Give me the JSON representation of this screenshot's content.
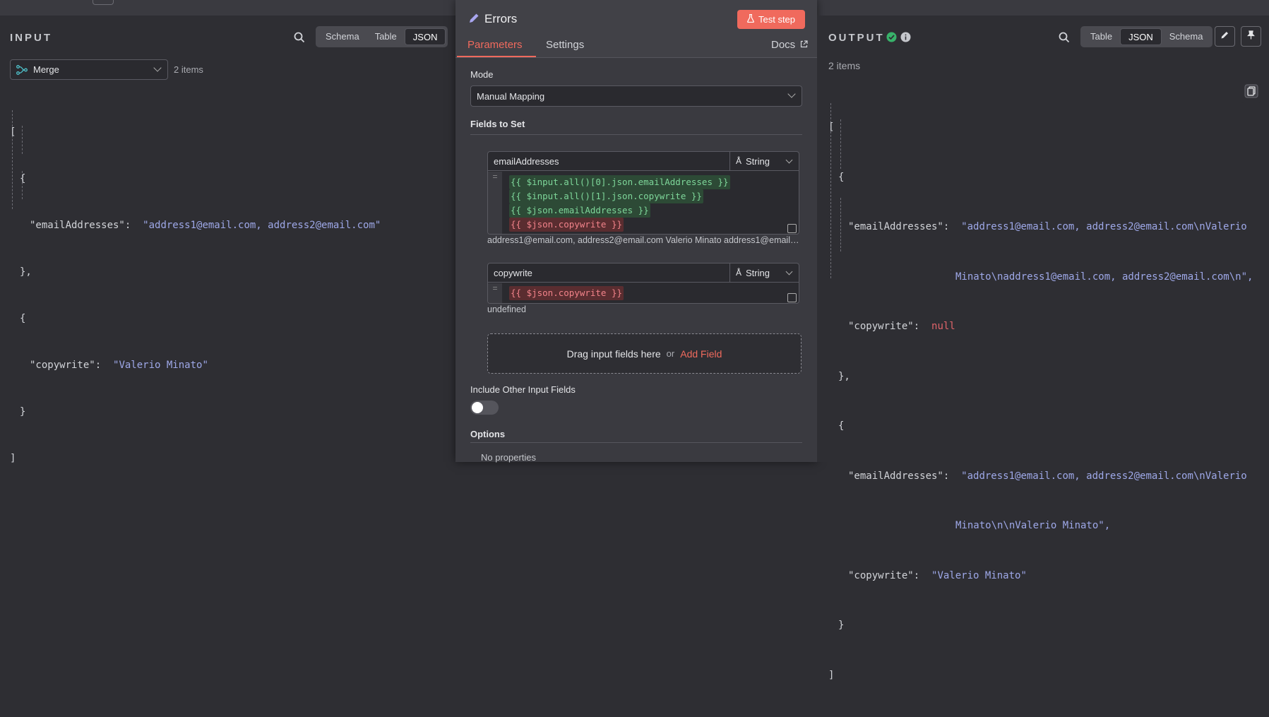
{
  "topbar": {
    "ghost_text": ""
  },
  "input": {
    "title": "INPUT",
    "views": [
      "Schema",
      "Table",
      "JSON"
    ],
    "active_view": "JSON",
    "node_select": "Merge",
    "item_count": "2 items",
    "json_lines": [
      "[",
      "{",
      "\"emailAddresses\":",
      "\"address1@email.com, address2@email.com\"",
      "},",
      "{",
      "\"copywrite\":",
      "\"Valerio Minato\"",
      "}",
      "]"
    ]
  },
  "node": {
    "title": "Errors",
    "test_button": "Test step",
    "tabs": [
      "Parameters",
      "Settings"
    ],
    "active_tab": "Parameters",
    "docs": "Docs",
    "mode_label": "Mode",
    "mode_value": "Manual Mapping",
    "fields_label": "Fields to Set",
    "fields": [
      {
        "name": "emailAddresses",
        "type": "String",
        "expressions": [
          {
            "text": "{{ $input.all()[0].json.emailAddresses }}",
            "status": "ok"
          },
          {
            "text": "{{ $input.all()[1].json.copywrite }}",
            "status": "ok"
          },
          {
            "text": "{{ $json.emailAddresses }}",
            "status": "ok"
          },
          {
            "text": "{{ $json.copywrite }}",
            "status": "bad"
          }
        ],
        "result": "address1@email.com, address2@email.com Valerio Minato address1@email...."
      },
      {
        "name": "copywrite",
        "type": "String",
        "expressions": [
          {
            "text": "{{ $json.copywrite }}",
            "status": "bad"
          }
        ],
        "result": "undefined"
      }
    ],
    "drop_text": "Drag input fields here",
    "drop_or": "or",
    "add_field": "Add Field",
    "include_label": "Include Other Input Fields",
    "include_enabled": false,
    "options_label": "Options",
    "no_properties": "No properties"
  },
  "output": {
    "title": "OUTPUT",
    "views": [
      "Table",
      "JSON",
      "Schema"
    ],
    "active_view": "JSON",
    "item_count": "2 items",
    "items": [
      {
        "email_key": "\"emailAddresses\":",
        "email_line1": "\"address1@email.com, address2@email.com\\nValerio",
        "email_line2": "Minato\\naddress1@email.com, address2@email.com\\n\",",
        "copy_key": "\"copywrite\":",
        "copy_val": "null"
      },
      {
        "email_key": "\"emailAddresses\":",
        "email_line1": "\"address1@email.com, address2@email.com\\nValerio",
        "email_line2": "Minato\\n\\nValerio Minato\",",
        "copy_key": "\"copywrite\":",
        "copy_val": "\"Valerio Minato\""
      }
    ]
  },
  "colors": {
    "accent": "#f06a5d",
    "string": "#9ea8e8",
    "null": "#e0646a",
    "success": "#38b26a"
  }
}
